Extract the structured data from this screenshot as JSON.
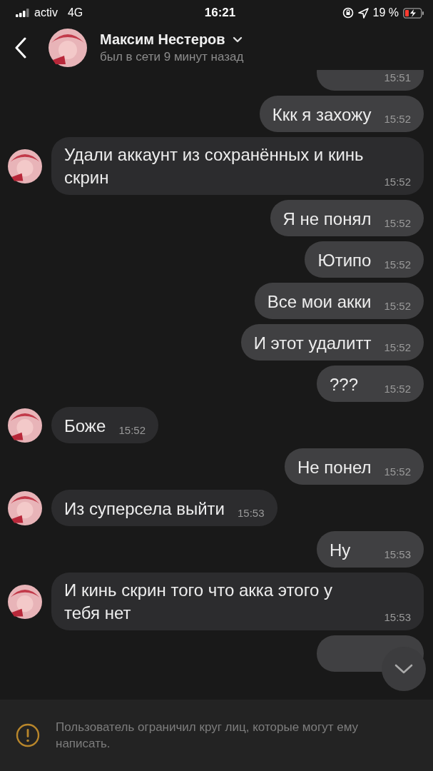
{
  "status_bar": {
    "carrier": "activ",
    "network": "4G",
    "time": "16:21",
    "battery": "19 %"
  },
  "header": {
    "name": "Максим Нестеров",
    "status": "был в сети 9 минут назад"
  },
  "messages": [
    {
      "kind": "outgoing",
      "time": "15:51"
    },
    {
      "kind": "outgoing",
      "text": "Ккк я захожу",
      "time": "15:52"
    },
    {
      "kind": "incoming",
      "text": "Удали аккаунт из сохранённых и кинь скрин",
      "time": "15:52"
    },
    {
      "kind": "outgoing",
      "text": "Я не понял",
      "time": "15:52"
    },
    {
      "kind": "outgoing",
      "text": "Ютипо",
      "time": "15:52"
    },
    {
      "kind": "outgoing",
      "text": "Все мои акки",
      "time": "15:52"
    },
    {
      "kind": "outgoing",
      "text": "И этот удалитт",
      "time": "15:52"
    },
    {
      "kind": "outgoing",
      "text": "???",
      "time": "15:52"
    },
    {
      "kind": "incoming",
      "text": "Боже",
      "time": "15:52"
    },
    {
      "kind": "outgoing",
      "text": "Не понел",
      "time": "15:52"
    },
    {
      "kind": "incoming",
      "text": "Из суперсела выйти",
      "time": "15:53"
    },
    {
      "kind": "outgoing",
      "text": "Ну",
      "time": "15:53"
    },
    {
      "kind": "incoming",
      "text": "И кинь скрин того что акка этого у тебя нет",
      "time": "15:53"
    },
    {
      "kind": "outgoing"
    }
  ],
  "notice": "Пользователь ограничил круг лиц, которые могут ему написать."
}
